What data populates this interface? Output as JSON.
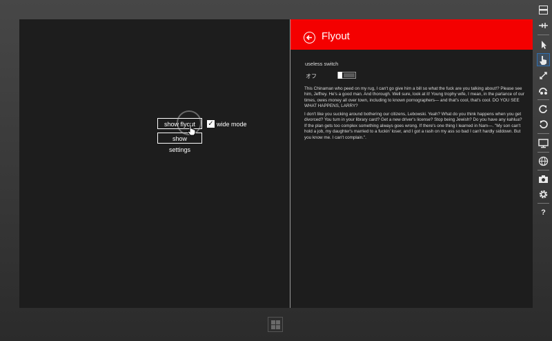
{
  "app": {
    "show_flyout_label": "show flyout",
    "show_settings_label": "show settings",
    "wide_mode_label": "wide mode",
    "wide_mode_checked": true
  },
  "flyout": {
    "title": "Flyout",
    "accent_color": "#f40000",
    "toggle": {
      "header": "useless switch",
      "state_label": "オフ",
      "value": "off"
    },
    "paragraphs": [
      "This Chinaman who peed on my rug, I can't go give him a bill so what the fuck are you talking about!? Please see him, Jeffrey. He's a good man. And thorough. Well sure, look at it! Young trophy wife, I mean, in the parlance of our times, owes money all over town, including to known pornographers— and that's cool, that's cool. DO YOU SEE WHAT HAPPENS, LARRY?",
      "I don't like you sucking around bothering our citizens, Lebowski. Yeah? What do you think happens when you get divorced? You turn in your library card? Get a new driver's license? Stop being Jewish? Do you have any kahlua? If the plan gets too complex something always goes wrong. If there's one thing I learned in Nam—. \"My son can't hold a job, my daughter's married to a fuckin' loser, and I got a rash on my ass so bad I can't hardly siddown. But you know me. I can't complain.\"."
    ]
  },
  "sidebar": {
    "icons": [
      "minimize-icon",
      "pin-icon",
      "mouse-mode-icon",
      "touch-mode-icon",
      "pinch-zoom-icon",
      "rotate-touch-icon",
      "rotate-clockwise-icon",
      "rotate-counterclockwise-icon",
      "resolution-icon",
      "location-icon",
      "screenshot-icon",
      "settings-icon",
      "help-icon"
    ],
    "help_label": "?"
  },
  "device": {
    "windows_button_icon": "windows-logo-icon"
  }
}
